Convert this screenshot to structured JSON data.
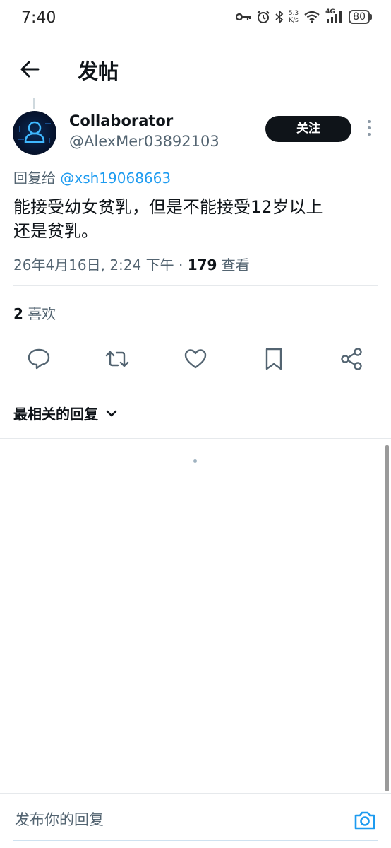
{
  "status_bar": {
    "time": "7:40",
    "speed_value": "5.3",
    "speed_unit": "K/s",
    "network": "4G",
    "battery": "80"
  },
  "header": {
    "title": "发帖"
  },
  "post": {
    "author_name": "Collaborator",
    "author_handle": "@AlexMer03892103",
    "follow_label": "关注",
    "reply_prefix": "回复给",
    "reply_handle": "@xsh19068663",
    "text_line1": "能接受幼女贫乳，但是不能接受12岁以上",
    "text_line2": "还是贫乳。",
    "timestamp": "26年4月16日, 2:24 下午 · ",
    "views_count": "179",
    "views_label": " 查看",
    "likes_count": "2",
    "likes_label": " 喜欢"
  },
  "actions": {
    "reply_icon": "reply-icon",
    "repost_icon": "repost-icon",
    "like_icon": "heart-icon",
    "bookmark_icon": "bookmark-icon",
    "share_icon": "share-icon"
  },
  "replies": {
    "sort_label": "最相关的回复"
  },
  "compose": {
    "placeholder": "发布你的回复"
  },
  "colors": {
    "accent": "#1d9bf0",
    "text": "#0f1419",
    "muted": "#536471",
    "button_bg": "#0f1419"
  }
}
